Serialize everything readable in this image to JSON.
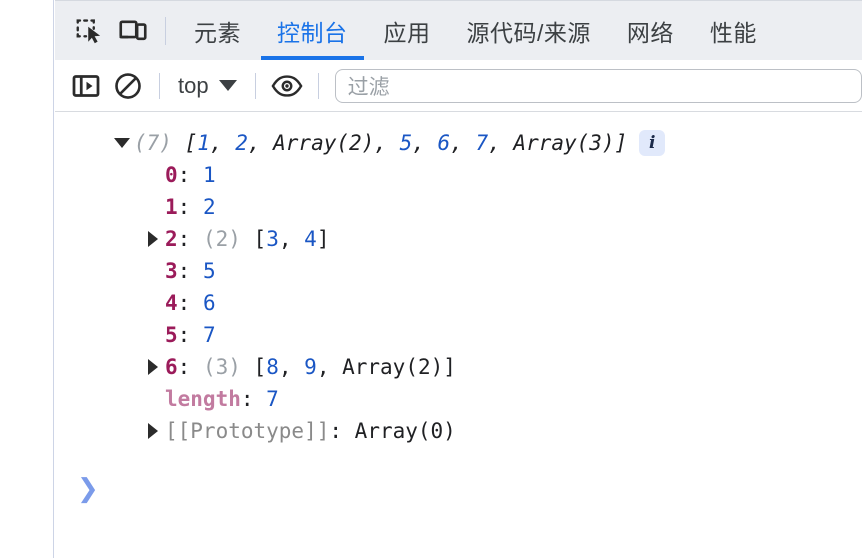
{
  "window": {
    "panel_name": "devtools-console"
  },
  "tabbar": {
    "icons": [
      {
        "name": "inspect-element-icon",
        "title": "检查元素"
      },
      {
        "name": "device-toolbar-icon",
        "title": "切换设备工具栏"
      }
    ],
    "tabs": [
      {
        "label": "元素",
        "active": false
      },
      {
        "label": "控制台",
        "active": true
      },
      {
        "label": "应用",
        "active": false
      },
      {
        "label": "源代码/来源",
        "active": false
      },
      {
        "label": "网络",
        "active": false
      },
      {
        "label": "性能",
        "active": false
      }
    ],
    "active_tab": "控制台",
    "accent_color": "#1a73e8",
    "background_color": "#eceef2"
  },
  "toolbar": {
    "sidebar_toggle": "console-sidebar-toggle",
    "clear_console": "clear-console",
    "context": {
      "label": "top",
      "options": [
        "top"
      ]
    },
    "eye_icon": "live-expression-eye",
    "filter": {
      "value": "",
      "placeholder": "过滤"
    }
  },
  "console": {
    "expanded_root": true,
    "lines": [
      {
        "id": "root",
        "arrow": "down",
        "indent": 0,
        "count": "(7)",
        "preview": "[1, 2, Array(2), 5, 6, 7, Array(3)]",
        "info_badge": "i"
      },
      {
        "id": "idx-0",
        "arrow": "none",
        "indent": 1,
        "key": "0",
        "value": "1",
        "value_type": "number"
      },
      {
        "id": "idx-1",
        "arrow": "none",
        "indent": 1,
        "key": "1",
        "value": "2",
        "value_type": "number"
      },
      {
        "id": "idx-2",
        "arrow": "right",
        "indent": 1,
        "key": "2",
        "count": "(2)",
        "value": "[3, 4]",
        "value_type": "array"
      },
      {
        "id": "idx-3",
        "arrow": "none",
        "indent": 1,
        "key": "3",
        "value": "5",
        "value_type": "number"
      },
      {
        "id": "idx-4",
        "arrow": "none",
        "indent": 1,
        "key": "4",
        "value": "6",
        "value_type": "number"
      },
      {
        "id": "idx-5",
        "arrow": "none",
        "indent": 1,
        "key": "5",
        "value": "7",
        "value_type": "number"
      },
      {
        "id": "idx-6",
        "arrow": "right",
        "indent": 1,
        "key": "6",
        "count": "(3)",
        "value": "[8, 9, Array(2)]",
        "value_type": "array"
      },
      {
        "id": "length",
        "arrow": "none",
        "indent": 1,
        "key": "length",
        "value": "7",
        "value_type": "number"
      },
      {
        "id": "prototype",
        "arrow": "right",
        "indent": 1,
        "key": "[[Prototype]]",
        "value": "Array(0)",
        "value_type": "proto"
      }
    ],
    "prompt": {
      "chevron": "❯",
      "value": ""
    },
    "colors": {
      "number": "#1a56c4",
      "key": "#9b1b5a",
      "length_key": "#c27ba0",
      "prototype": "#8a8a8a",
      "count": "#9aa0a6",
      "text": "#202124",
      "prompt": "#7b9bea"
    }
  }
}
